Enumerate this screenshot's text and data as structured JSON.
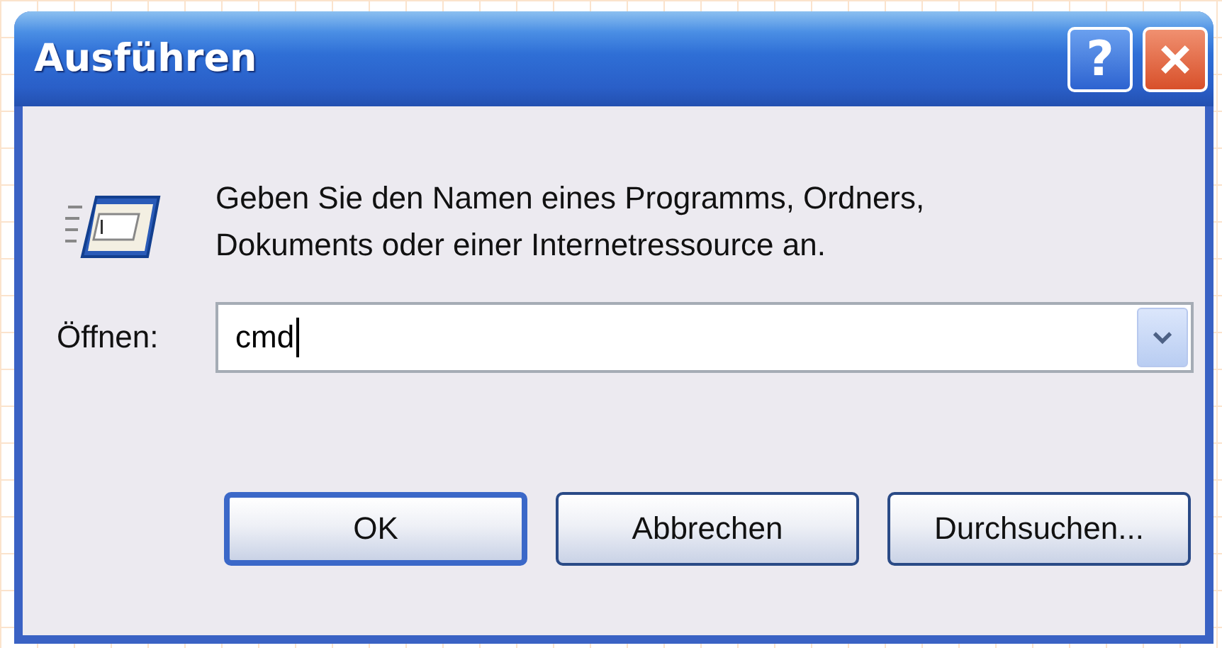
{
  "window": {
    "title": "Ausführen",
    "title_buttons": [
      {
        "kind": "help",
        "label": "?"
      },
      {
        "kind": "close"
      }
    ]
  },
  "prompt": "Geben Sie den Namen eines Programms, Ordners, Dokuments oder einer Internetressource an.",
  "open_field": {
    "label": "Öffnen:",
    "value": "cmd"
  },
  "buttons": [
    {
      "label": "OK",
      "default": true
    },
    {
      "label": "Abbrechen",
      "default": false
    },
    {
      "label": "Durchsuchen...",
      "default": false
    }
  ]
}
